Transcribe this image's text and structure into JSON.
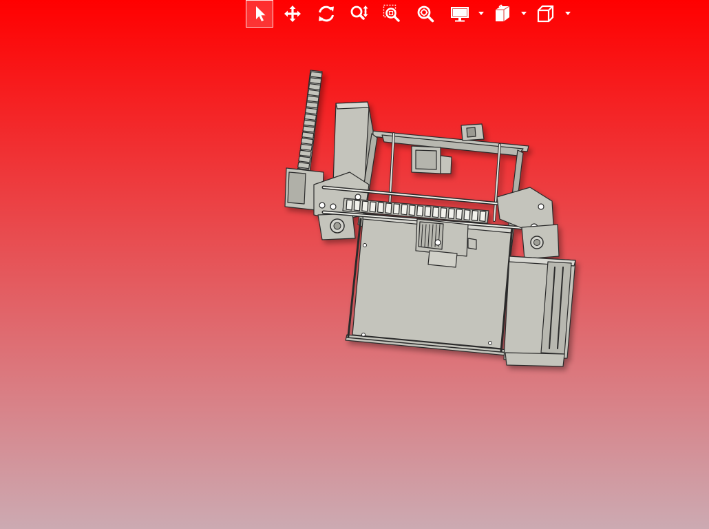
{
  "viewport": {
    "background_top": "#ff0000",
    "background_bottom": "#ccaab2"
  },
  "toolbar": {
    "icon_color": "#ffffff",
    "active_tool": "select",
    "items": [
      {
        "name": "select-tool-button",
        "icon": "cursor-arrow-icon",
        "active": true
      },
      {
        "name": "pan-tool-button",
        "icon": "move-arrows-icon"
      },
      {
        "name": "rotate-tool-button",
        "icon": "rotate-icon"
      },
      {
        "name": "zoom-tool-button",
        "icon": "zoom-vertical-icon"
      },
      {
        "name": "zoom-window-button",
        "icon": "zoom-window-icon"
      },
      {
        "name": "zoom-fit-button",
        "icon": "zoom-fit-icon"
      },
      {
        "name": "display-mode-button",
        "icon": "monitor-icon",
        "dropdown": true
      },
      {
        "name": "section-view-button",
        "icon": "section-cube-icon",
        "dropdown": true
      },
      {
        "name": "standard-views-button",
        "icon": "view-cube-icon",
        "dropdown": true
      }
    ]
  },
  "model": {
    "part_color": "#c4c4bc",
    "edge_color": "#2b2b2b"
  }
}
